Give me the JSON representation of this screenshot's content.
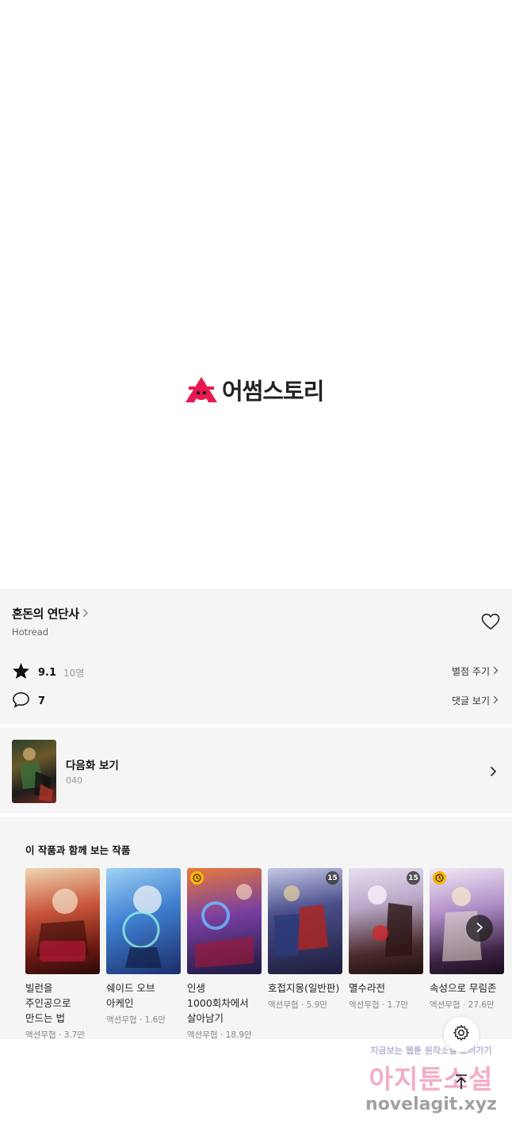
{
  "brand": {
    "name": "어썸스토리",
    "accent": "#e8194f"
  },
  "work": {
    "title": "혼돈의 연단사",
    "author": "Hotread",
    "rating": "9.1",
    "rating_count": "10명",
    "rate_label": "별점 주기",
    "comment_count": "7",
    "comment_label": "댓글 보기"
  },
  "next_episode": {
    "label": "다음화 보기",
    "episode": "040"
  },
  "recommendations": {
    "title": "이 작품과 함께 보는 작품",
    "items": [
      {
        "title": "빌런을 주인공으로 만드는 법",
        "genre": "액션무협",
        "views": "3.7만",
        "badge": "",
        "wait_free": false
      },
      {
        "title": "쉐이드 오브 아케인",
        "genre": "액션무협",
        "views": "1.6만",
        "badge": "",
        "wait_free": false
      },
      {
        "title": "인생 1000회차에서 살아남기",
        "genre": "액션무협",
        "views": "18.9만",
        "badge": "",
        "wait_free": true
      },
      {
        "title": "호접지몽(일반판)",
        "genre": "액션무협",
        "views": "5.9만",
        "badge": "15",
        "wait_free": false
      },
      {
        "title": "멸수라전",
        "genre": "액션무협",
        "views": "1.7만",
        "badge": "15",
        "wait_free": false
      },
      {
        "title": "속성으로 무림존",
        "genre": "액션무협",
        "views": "27.6만",
        "badge": "",
        "wait_free": true
      }
    ]
  },
  "icons": {
    "logo": "awesome-story-logo-icon",
    "title_chevron": "chevron-right-icon",
    "like": "heart-icon",
    "rating": "star-icon",
    "comments": "comment-bubble-icon",
    "carousel_next": "chevron-right-icon",
    "settings": "gear-icon",
    "scroll_top": "arrow-up-icon",
    "wait_free": "clock-icon"
  },
  "watermark": {
    "line1": "지금보는 웹툰 원작소설 보러가기",
    "line2": "아지툰소설",
    "line3": "novelagit.xyz"
  }
}
